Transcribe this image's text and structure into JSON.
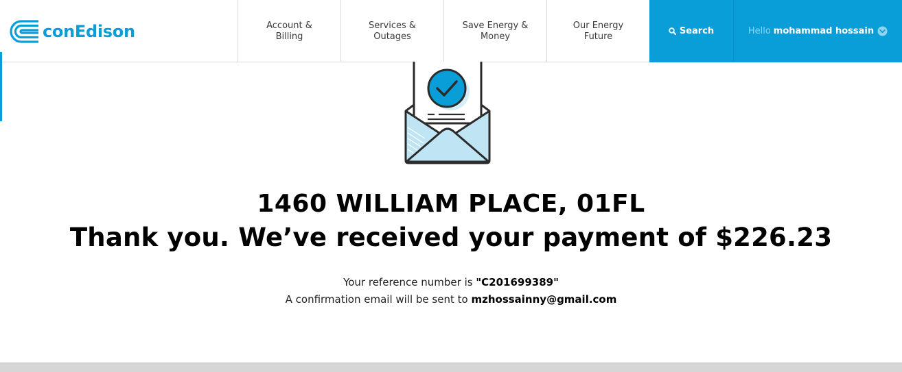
{
  "brand": {
    "name": "conEdison",
    "color": "#0a9ed9"
  },
  "nav": [
    {
      "label": "Account &\nBilling"
    },
    {
      "label": "Services &\nOutages"
    },
    {
      "label": "Save Energy &\nMoney"
    },
    {
      "label": "Our Energy\nFuture"
    }
  ],
  "search": {
    "label": "Search",
    "icon": "search-icon"
  },
  "user": {
    "greeting": "Hello",
    "name": "mohammad hossain",
    "icon": "chevron-down-icon"
  },
  "illustration": {
    "icon": "envelope-checkmark-icon"
  },
  "confirmation": {
    "address": "1460 WILLIAM PLACE, 01FL",
    "thanks": "Thank you. We’ve received your payment of $226.23",
    "reference_prefix": "Your reference number is ",
    "reference_number": "\"C201699389\"",
    "email_prefix": "A confirmation email will be sent to ",
    "email": "mzhossainny@gmail.com"
  }
}
